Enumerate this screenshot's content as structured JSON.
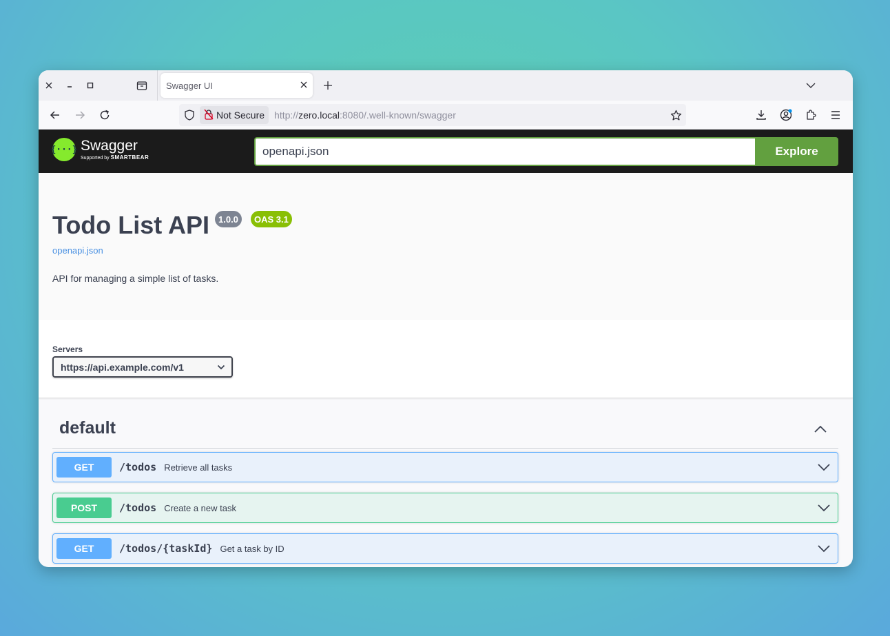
{
  "browser": {
    "tab_title": "Swagger UI",
    "security_label": "Not Secure",
    "url_scheme": "http://",
    "url_host": "zero.local",
    "url_rest": ":8080/.well-known/swagger"
  },
  "topbar": {
    "logo_word": "Swagger",
    "logo_sub": "Supported by",
    "logo_brand": "SMARTBEAR",
    "spec_input_value": "openapi.json",
    "explore_label": "Explore"
  },
  "info": {
    "title": "Todo List API",
    "version": "1.0.0",
    "oas": "OAS 3.1",
    "spec_link": "openapi.json",
    "description": "API for managing a simple list of tasks."
  },
  "servers": {
    "label": "Servers",
    "selected": "https://api.example.com/v1"
  },
  "tag": {
    "name": "default"
  },
  "operations": [
    {
      "method": "GET",
      "path": "/todos",
      "summary": "Retrieve all tasks"
    },
    {
      "method": "POST",
      "path": "/todos",
      "summary": "Create a new task"
    },
    {
      "method": "GET",
      "path": "/todos/{taskId}",
      "summary": "Get a task by ID"
    }
  ],
  "colors": {
    "get": "#61affe",
    "post": "#49cc90",
    "explore": "#62a03f",
    "oas_badge": "#89bf04",
    "version_badge": "#7d8492",
    "topbar": "#1b1b1b"
  },
  "icons": {
    "window_controls": [
      "close-icon",
      "minimize-icon",
      "maximize-icon"
    ],
    "tab_group": "tab-manager-icon",
    "navigation": [
      "back-arrow-icon",
      "forward-arrow-icon",
      "reload-icon"
    ],
    "toolbar": [
      "download-icon",
      "account-icon",
      "extensions-icon",
      "menu-icon"
    ]
  }
}
